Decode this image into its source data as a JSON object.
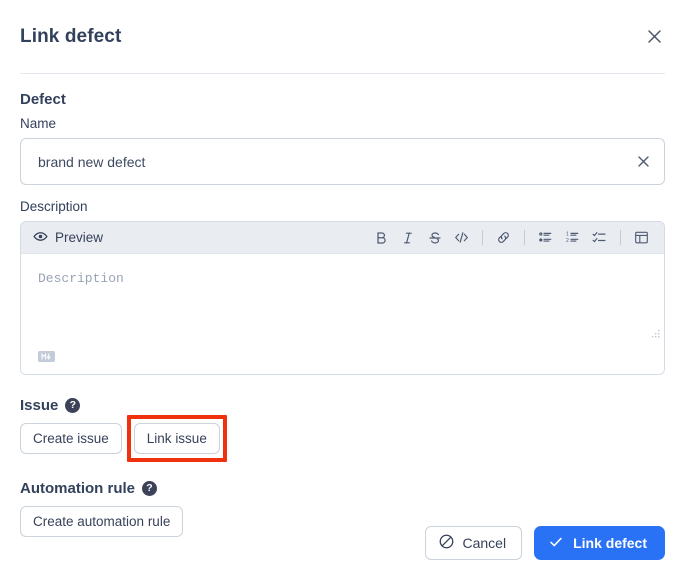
{
  "dialog": {
    "title": "Link defect",
    "close_icon": "close-icon"
  },
  "defect": {
    "heading": "Defect",
    "name_label": "Name",
    "name_value": "brand new defect",
    "name_placeholder": "Name",
    "clear_icon": "close-icon"
  },
  "description": {
    "label": "Description",
    "preview_label": "Preview",
    "preview_icon": "eye-icon",
    "placeholder": "Description",
    "value": "",
    "markdown_badge": "markdown-icon",
    "toolbar": [
      {
        "name": "bold-icon",
        "label": "B"
      },
      {
        "name": "italic-icon",
        "label": "I"
      },
      {
        "name": "strikethrough-icon",
        "label": "S"
      },
      {
        "name": "code-icon",
        "label": "</>"
      },
      {
        "name": "link-icon",
        "label": "link"
      },
      {
        "name": "bulleted-list-icon",
        "label": "bullet list"
      },
      {
        "name": "numbered-list-icon",
        "label": "numbered list"
      },
      {
        "name": "task-list-icon",
        "label": "task list"
      },
      {
        "name": "table-icon",
        "label": "table"
      }
    ]
  },
  "issue": {
    "heading": "Issue",
    "help_icon": "question-mark-icon",
    "create_label": "Create issue",
    "link_label": "Link issue",
    "highlight_color": "#ef3110"
  },
  "automation": {
    "heading": "Automation rule",
    "help_icon": "question-mark-icon",
    "create_label": "Create automation rule"
  },
  "footer": {
    "cancel_label": "Cancel",
    "cancel_icon": "ban-icon",
    "submit_label": "Link defect",
    "submit_icon": "check-icon",
    "submit_color": "#2a72f5"
  }
}
